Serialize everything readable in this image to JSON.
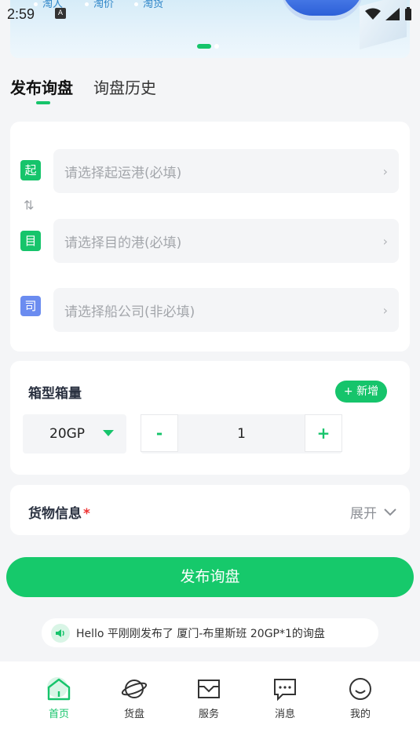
{
  "status_bar": {
    "time": "2:59",
    "ime_label": "A"
  },
  "banner": {
    "tags": [
      "淘人",
      "淘价",
      "淘货"
    ]
  },
  "tabs": [
    {
      "label": "发布询盘",
      "active": true
    },
    {
      "label": "询盘历史",
      "active": false
    }
  ],
  "ports": {
    "origin_badge": "起",
    "origin_placeholder": "请选择起运港(必填)",
    "dest_badge": "目",
    "dest_placeholder": "请选择目的港(必填)",
    "carrier_badge": "司",
    "carrier_placeholder": "请选择船公司(非必填)"
  },
  "container": {
    "title": "箱型箱量",
    "add_label": "+ 新增",
    "type_value": "20GP",
    "minus_label": "-",
    "quantity": "1",
    "plus_label": "+"
  },
  "cargo": {
    "title": "货物信息",
    "required_mark": "*",
    "expand_label": "展开"
  },
  "publish_label": "发布询盘",
  "notice_text": "Hello 平刚刚发布了 厦门-布里斯班 20GP*1的询盘",
  "nav": [
    {
      "label": "首页",
      "icon": "home-icon",
      "active": true
    },
    {
      "label": "货盘",
      "icon": "planet-icon",
      "active": false
    },
    {
      "label": "服务",
      "icon": "inbox-icon",
      "active": false
    },
    {
      "label": "消息",
      "icon": "message-icon",
      "active": false
    },
    {
      "label": "我的",
      "icon": "smile-icon",
      "active": false
    }
  ],
  "colors": {
    "accent": "#16c46b",
    "blue_badge": "#6b8cf0",
    "background": "#f4f5f7"
  }
}
